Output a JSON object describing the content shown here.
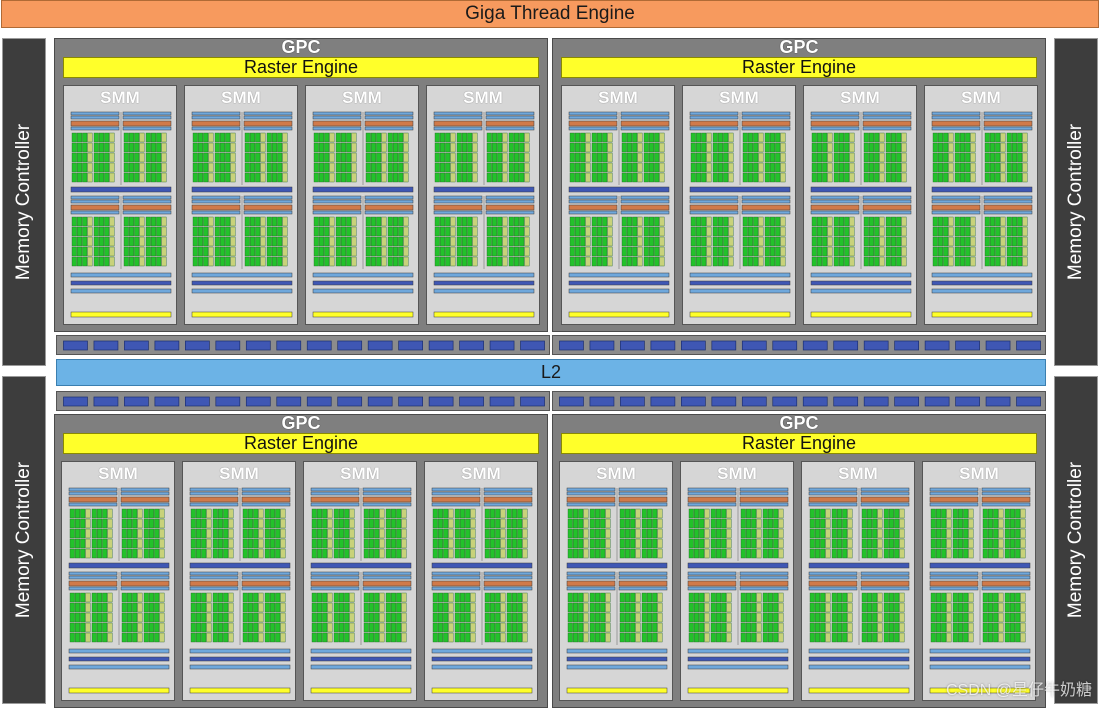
{
  "top_bar": {
    "label": "Giga Thread Engine"
  },
  "memory_controllers": [
    {
      "label": "Memory Controller"
    },
    {
      "label": "Memory Controller"
    },
    {
      "label": "Memory Controller"
    },
    {
      "label": "Memory Controller"
    }
  ],
  "gpcs": [
    {
      "label": "GPC",
      "raster_label": "Raster Engine",
      "smms": [
        "SMM",
        "SMM",
        "SMM",
        "SMM"
      ]
    },
    {
      "label": "GPC",
      "raster_label": "Raster Engine",
      "smms": [
        "SMM",
        "SMM",
        "SMM",
        "SMM"
      ]
    },
    {
      "label": "GPC",
      "raster_label": "Raster Engine",
      "smms": [
        "SMM",
        "SMM",
        "SMM",
        "SMM"
      ]
    },
    {
      "label": "GPC",
      "raster_label": "Raster Engine",
      "smms": [
        "SMM",
        "SMM",
        "SMM",
        "SMM"
      ]
    }
  ],
  "l2": {
    "label": "L2"
  },
  "watermark": "CSDN @星仔牛奶糖",
  "colors": {
    "giga_thread": "#f79a5e",
    "memory_controller": "#3d3d3d",
    "gpc": "#7f7f7f",
    "raster_engine": "#ffff2a",
    "smm": "#d6d6d6",
    "l2": "#6cb3e6",
    "core": "#22c22a",
    "ldst": "#c8d27a",
    "register": "#d07a4a",
    "dispatch": "#6fa8dc",
    "bus_block": "#3f57b4"
  }
}
